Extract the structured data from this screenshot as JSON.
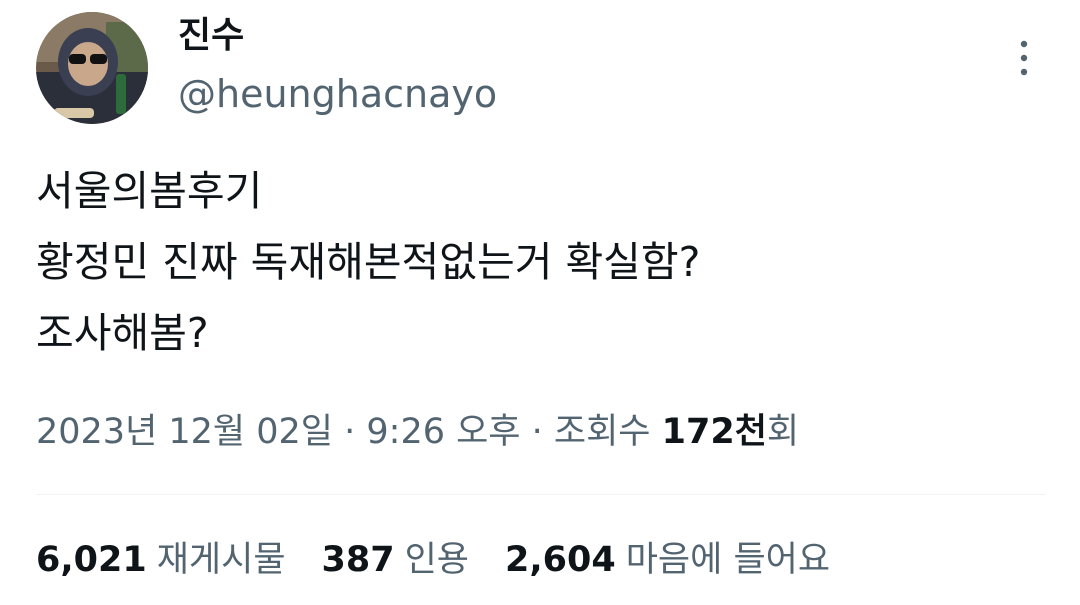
{
  "author": {
    "display_name": "진수",
    "handle": "@heunghacnayo"
  },
  "more_icon": "more-vertical-icon",
  "tweet": {
    "lines": [
      "서울의봄후기",
      "황정민 진짜 독재해본적없는거 확실함?",
      "조사해봄?"
    ]
  },
  "meta": {
    "date": "2023년 12월 02일",
    "separator1": " · ",
    "time": "9:26 오후",
    "separator2": " · ",
    "views_label": "조회수 ",
    "views_count": "172천",
    "views_suffix": "회"
  },
  "stats": {
    "retweets": {
      "count": "6,021",
      "label": "재게시물"
    },
    "quotes": {
      "count": "387",
      "label": "인용"
    },
    "likes": {
      "count": "2,604",
      "label": "마음에 들어요"
    }
  },
  "colors": {
    "text": "#0f1419",
    "secondary": "#536471",
    "divider": "#eff3f4"
  }
}
